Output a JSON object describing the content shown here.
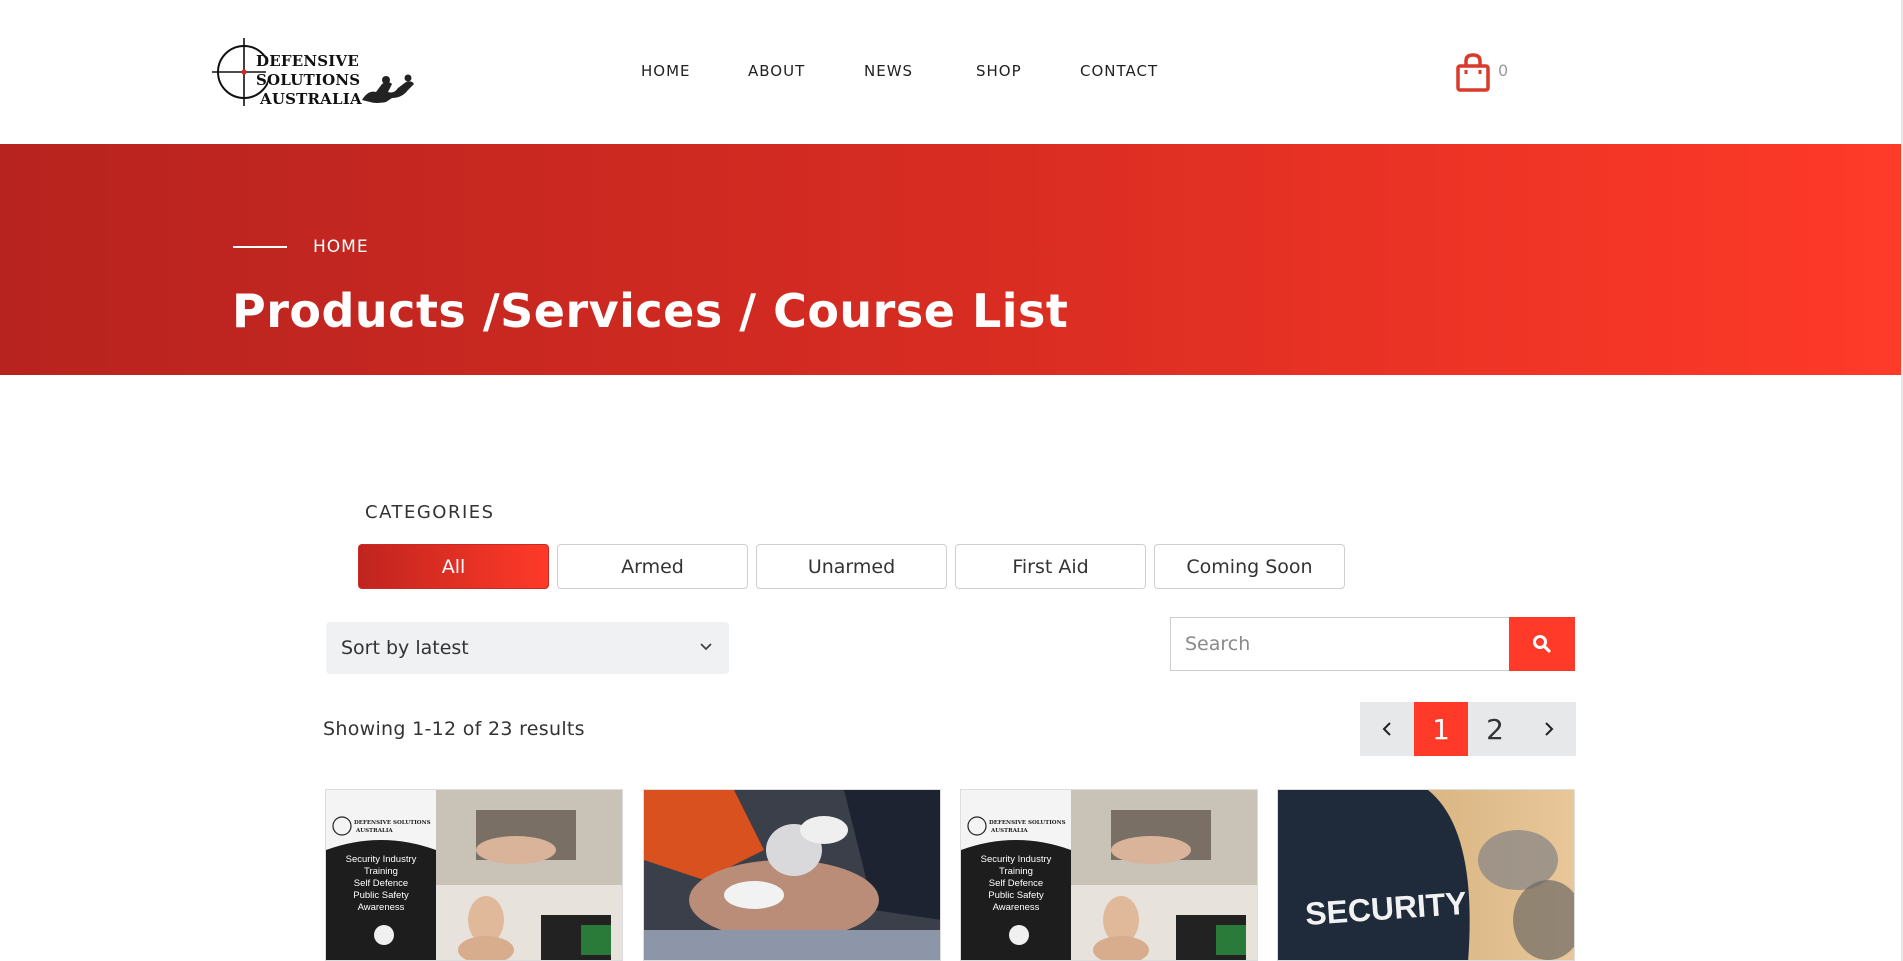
{
  "header": {
    "logo_line1": "DEFENSIVE SOLUTIONS",
    "logo_line2": "AUSTRALIA",
    "nav": [
      "HOME",
      "ABOUT",
      "NEWS",
      "SHOP",
      "CONTACT"
    ],
    "cart_count": "0"
  },
  "hero": {
    "breadcrumb": "HOME",
    "title": "Products /Services / Course List"
  },
  "categories": {
    "label": "CATEGORIES",
    "items": [
      "All",
      "Armed",
      "Unarmed",
      "First Aid",
      "Coming Soon"
    ],
    "active": "All"
  },
  "toolbar": {
    "sort_value": "Sort by latest",
    "search_placeholder": "Search"
  },
  "results": {
    "text": "Showing 1-12 of 23 results",
    "pages": [
      "1",
      "2"
    ],
    "current_page": "1"
  },
  "products": [
    {
      "banner_line1": "DEFENSIVE SOLUTIONS",
      "banner_line2": "AUSTRALIA",
      "banner_text": [
        "Security Industry",
        "Training",
        "Self Defence",
        "Public Safety",
        "Awareness"
      ]
    },
    {},
    {
      "banner_line1": "DEFENSIVE SOLUTIONS",
      "banner_line2": "AUSTRALIA",
      "banner_text": [
        "Security Industry",
        "Training",
        "Self Defence",
        "Public Safety",
        "Awareness"
      ]
    },
    {
      "jacket_text": "SECURITY"
    }
  ],
  "colors": {
    "accent": "#ff3a28",
    "accent_dark": "#b7231f",
    "pager_bg": "#e7e8ea",
    "sort_bg": "#f0f1f3"
  },
  "icons": {
    "cart": "shopping-bag-icon",
    "search": "search-icon",
    "sort": "chevron-down-icon",
    "prev": "chevron-left-icon",
    "next": "chevron-right-icon"
  }
}
